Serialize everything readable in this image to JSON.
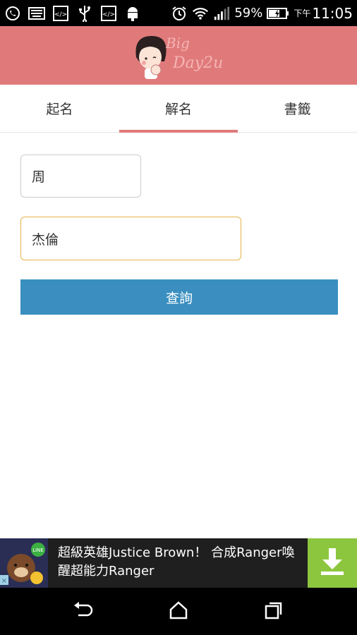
{
  "status_bar": {
    "battery_percent": "59%",
    "time_prefix": "下午",
    "time": "11:05",
    "icons": [
      "whatsapp-icon",
      "keyboard-icon",
      "code-icon",
      "usb-icon",
      "code-icon",
      "android-icon",
      "alarm-icon",
      "wifi-icon",
      "signal-icon",
      "battery-charging-icon"
    ]
  },
  "header": {
    "logo_line1": "Big",
    "logo_line2": "Day2u",
    "brand_color": "#e07a7a"
  },
  "tabs": [
    {
      "label": "起名",
      "active": false
    },
    {
      "label": "解名",
      "active": true
    },
    {
      "label": "書籤",
      "active": false
    }
  ],
  "form": {
    "surname_value": "周",
    "given_name_value": "杰倫",
    "query_label": "查詢",
    "button_color": "#3a8fc0"
  },
  "ad": {
    "text": "超級英雄Justice Brown！ 合成Ranger喚醒超能力Ranger",
    "badge": "LINE",
    "download_color": "#8cc63f"
  },
  "nav": {
    "items": [
      "back-icon",
      "home-icon",
      "recents-icon"
    ]
  }
}
